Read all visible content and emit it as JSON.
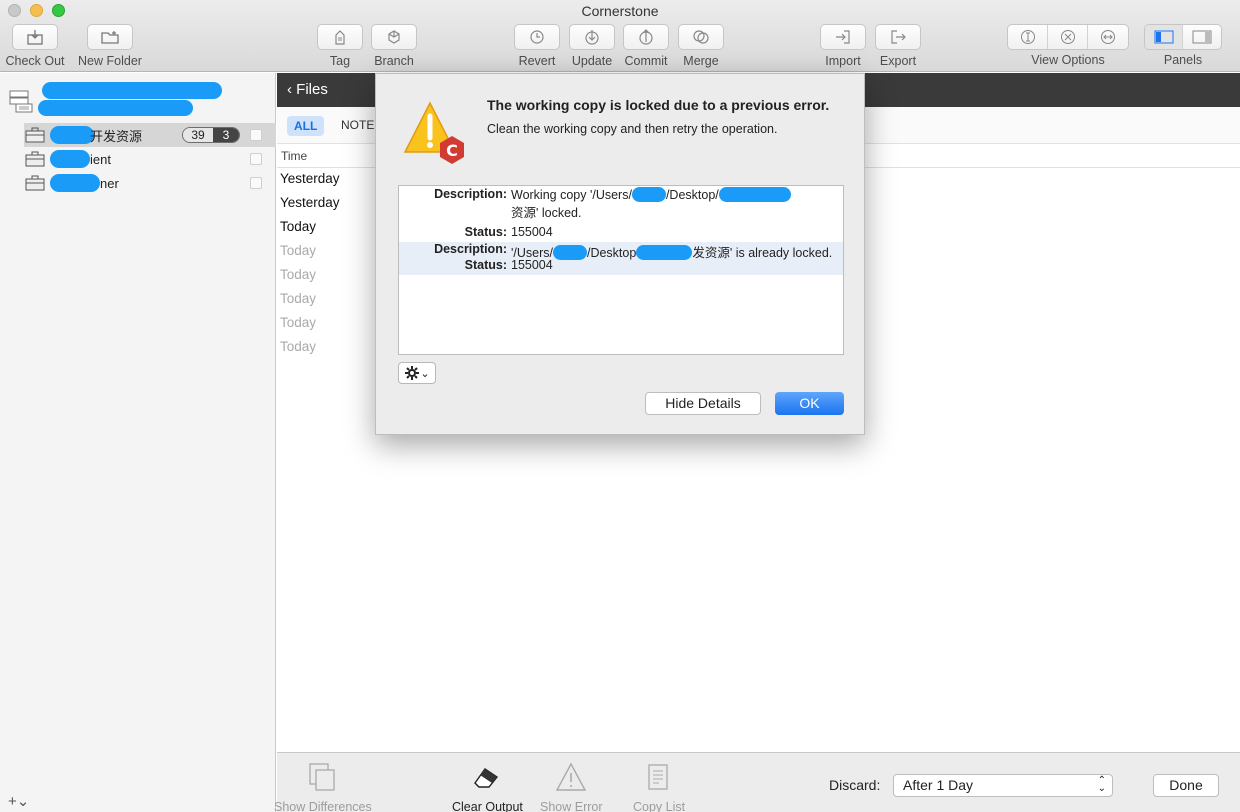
{
  "window": {
    "title": "Cornerstone"
  },
  "toolbar": {
    "check_out": "Check Out",
    "new_folder": "New Folder",
    "tag": "Tag",
    "branch": "Branch",
    "revert": "Revert",
    "update": "Update",
    "commit": "Commit",
    "merge": "Merge",
    "import": "Import",
    "export": "Export",
    "view_options": "View Options",
    "panels": "Panels"
  },
  "sidebar": {
    "repos": [
      {
        "name_visible": "开发资源",
        "count_a": "39",
        "count_b": "3"
      },
      {
        "name_visible": "ient"
      },
      {
        "name_visible": "ner"
      }
    ],
    "footer_add": "+⌄"
  },
  "main": {
    "back_label": "Files",
    "filter_all": "ALL",
    "filter_notes": "NOTES",
    "column_time": "Time",
    "times": [
      "Yesterday",
      "Yesterday",
      "Today",
      "Today",
      "Today",
      "Today",
      "Today",
      "Today"
    ]
  },
  "bottom": {
    "show_differences": "Show Differences",
    "clear_output": "Clear Output",
    "show_error": "Show Error",
    "copy_list": "Copy List",
    "discard_label": "Discard:",
    "discard_value": "After 1 Day",
    "done": "Done"
  },
  "dialog": {
    "title": "The working copy is locked due to a previous error.",
    "message": "Clean the working copy and then retry the operation.",
    "details": {
      "desc_key": "Description:",
      "status_key": "Status:",
      "desc1_a": "Working copy '/Users/",
      "desc1_b": "/Desktop/",
      "desc1_c": "资源' locked.",
      "status1": "155004",
      "desc2_a": "'/Users/",
      "desc2_b": "/Desktop",
      "desc2_c": "发资源' is already locked.",
      "status2": "155004"
    },
    "hide_details": "Hide Details",
    "ok": "OK"
  },
  "colors": {
    "accent": "#1b74f0",
    "redaction": "#1a9bf7",
    "files_bar": "#3a3a3a"
  }
}
